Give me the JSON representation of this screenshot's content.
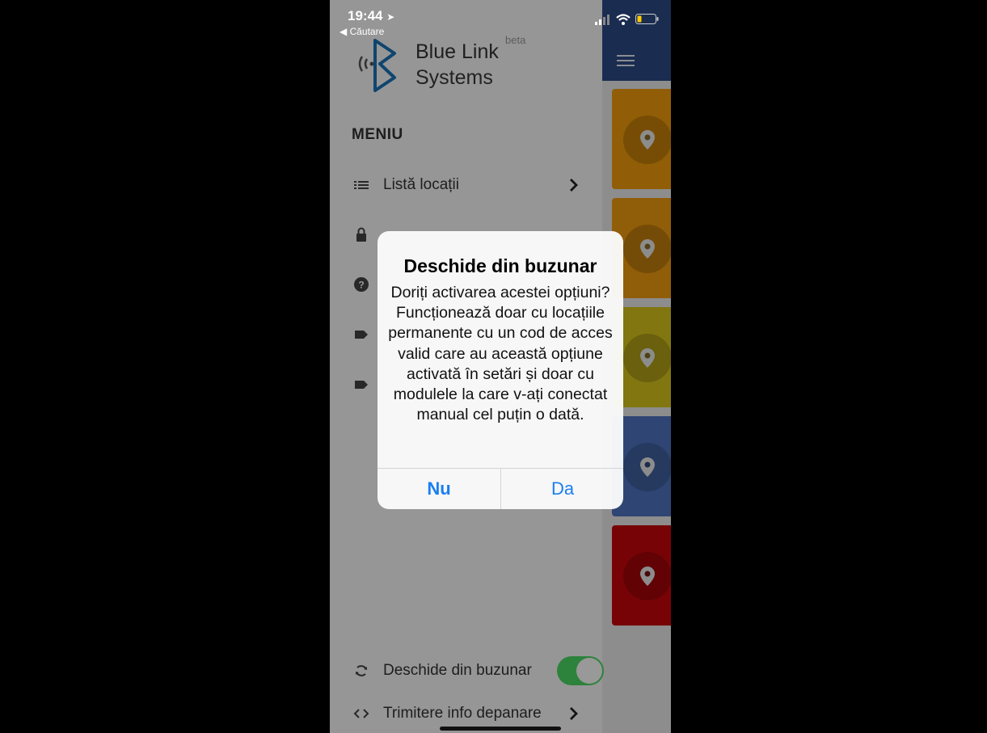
{
  "status_bar": {
    "time": "19:44",
    "location_arrow": "➤",
    "back_label": "◀ Căutare"
  },
  "logo": {
    "title": "Blue Link",
    "subtitle": "Systems",
    "badge": "beta",
    "color": "#1a73b8"
  },
  "drawer": {
    "heading": "MENIU",
    "items": [
      {
        "label": "Listă locații",
        "icon": "list-icon"
      },
      {
        "label": "",
        "icon": "lock-icon"
      },
      {
        "label": "",
        "icon": "help-icon"
      },
      {
        "label": "",
        "icon": "tag-icon"
      },
      {
        "label": "",
        "icon": "tag-icon"
      }
    ],
    "footer_items": [
      {
        "label": "Deschide din buzunar",
        "icon": "sync-icon",
        "toggle_on": true
      },
      {
        "label": "Trimitere info depanare",
        "icon": "code-icon"
      }
    ]
  },
  "tiles": [
    {
      "color": "#f29d0c"
    },
    {
      "color": "#f09b0f"
    },
    {
      "color": "#d8c51c"
    },
    {
      "color": "#4f74c2"
    },
    {
      "color": "#c9060a"
    }
  ],
  "alert": {
    "title": "Deschide din buzunar",
    "message": "Doriți activarea acestei opțiuni? Funcționează doar cu locațiile permanente cu un cod de acces valid care au această opțiune activată în setări și doar cu modulele la care v-ați conectat manual cel puțin o dată.",
    "no_label": "Nu",
    "yes_label": "Da",
    "button_color": "#1a7ef2"
  },
  "colors": {
    "header": "#2c4a86",
    "toggle_on": "#4cd964"
  }
}
